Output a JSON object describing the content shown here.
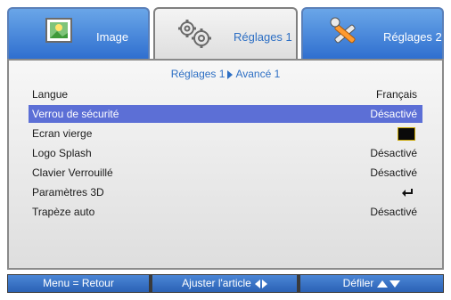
{
  "tabs": {
    "image": {
      "label": "Image"
    },
    "reglages1": {
      "label": "Réglages 1"
    },
    "reglages2": {
      "label": "Réglages 2"
    }
  },
  "breadcrumb": {
    "part1": "Réglages 1",
    "part2": "Avancé 1"
  },
  "rows": [
    {
      "name": "Langue",
      "value": "Français"
    },
    {
      "name": "Verrou de sécurité",
      "value": "Désactivé"
    },
    {
      "name": "Ecran vierge",
      "value": ""
    },
    {
      "name": "Logo Splash",
      "value": "Désactivé"
    },
    {
      "name": "Clavier Verrouillé",
      "value": "Désactivé"
    },
    {
      "name": "Paramètres 3D",
      "value": ""
    },
    {
      "name": "Trapèze auto",
      "value": "Désactivé"
    }
  ],
  "selected_row": 1,
  "footer": {
    "menu": "Menu = Retour",
    "adjust": "Ajuster l'article",
    "scroll": "Défiler"
  },
  "colors": {
    "accent": "#2d6fc4",
    "selected_row": "#5c6fd6",
    "tab_blue": "#2f6fcf"
  },
  "icons": {
    "image_tab": "image-icon",
    "reglages1_tab": "gears-icon",
    "reglages2_tab": "tools-icon",
    "paramètres_3d": "enter-icon",
    "ecran_vierge": "black-color-swatch"
  }
}
